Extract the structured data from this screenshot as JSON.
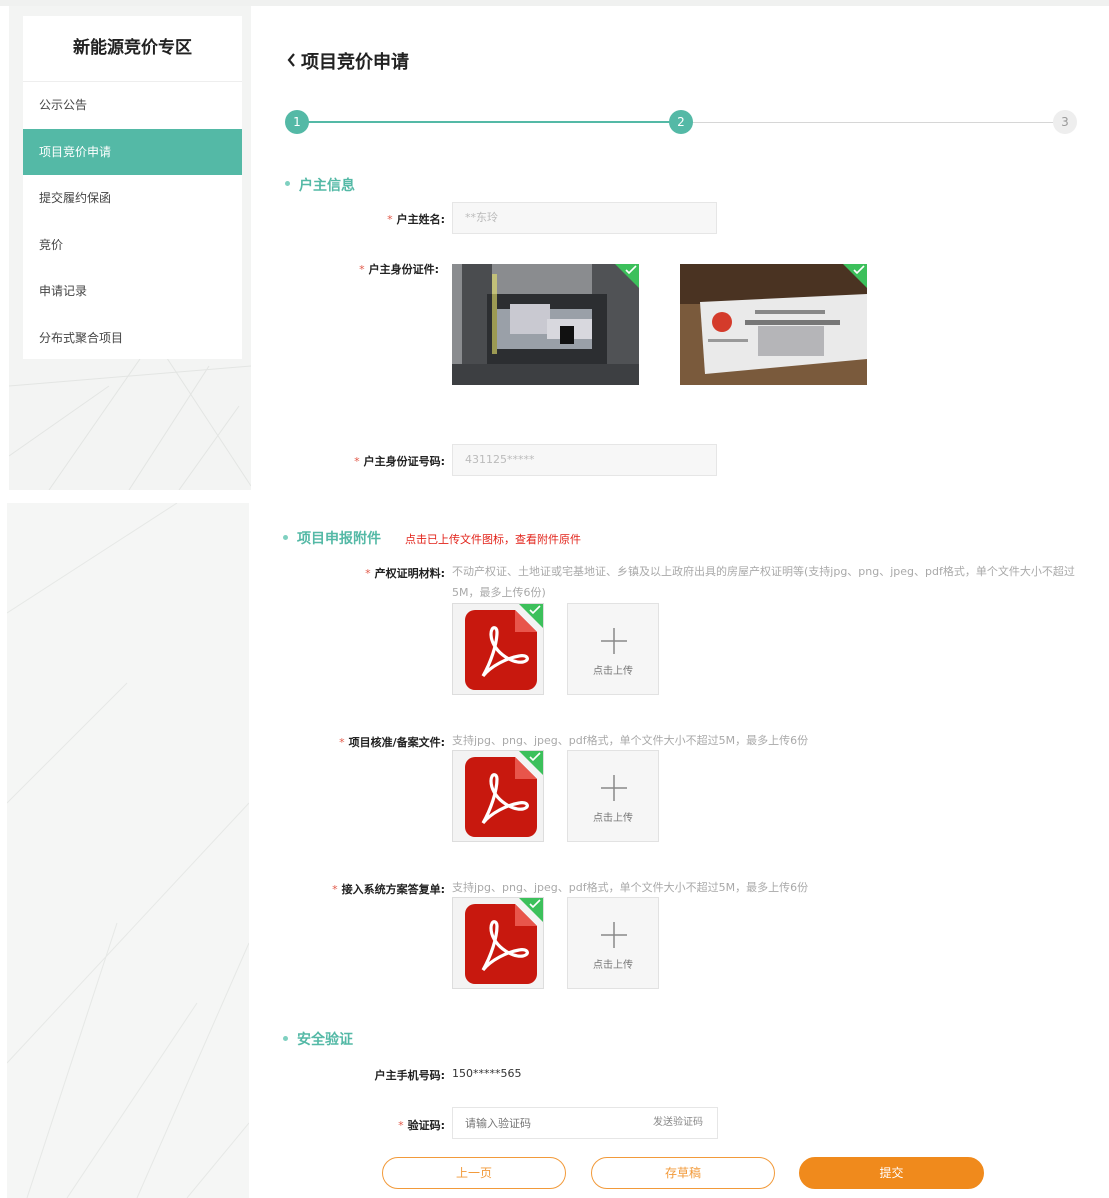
{
  "sidebar": {
    "title": "新能源竞价专区",
    "items": [
      {
        "label": "公示公告"
      },
      {
        "label": "项目竞价申请"
      },
      {
        "label": "提交履约保函"
      },
      {
        "label": "竞价"
      },
      {
        "label": "申请记录"
      },
      {
        "label": "分布式聚合项目"
      }
    ],
    "active_index": 1
  },
  "header": {
    "title": "项目竞价申请",
    "back_icon": "chevron-left-icon"
  },
  "steps": {
    "items": [
      "1",
      "2",
      "3"
    ],
    "current": 2
  },
  "owner_section": {
    "title": "户主信息",
    "name_label": "户主姓名:",
    "name_value": "**东玲",
    "id_doc_label": "户主身份证件:",
    "id_number_label": "户主身份证号码:",
    "id_number_value": "431125*****"
  },
  "attachments_section": {
    "title": "项目申报附件",
    "note": "点击已上传文件图标，查看附件原件",
    "fields": [
      {
        "label": "产权证明材料:",
        "hint": "不动产权证、土地证或宅基地证、乡镇及以上政府出具的房屋产权证明等(支持jpg、png、jpeg、pdf格式，单个文件大小不超过5M，最多上传6份)"
      },
      {
        "label": "项目核准/备案文件:",
        "hint": "支持jpg、png、jpeg、pdf格式，单个文件大小不超过5M，最多上传6份"
      },
      {
        "label": "接入系统方案答复单:",
        "hint": "支持jpg、png、jpeg、pdf格式，单个文件大小不超过5M，最多上传6份"
      }
    ],
    "upload_label": "点击上传",
    "file_icon": "pdf-icon"
  },
  "security_section": {
    "title": "安全验证",
    "phone_label": "户主手机号码:",
    "phone_value": "150*****565",
    "code_label": "验证码:",
    "code_placeholder": "请输入验证码",
    "send_code_label": "发送验证码"
  },
  "actions": {
    "prev": "上一页",
    "draft": "存草稿",
    "submit": "提交"
  },
  "required_mark": "*",
  "colors": {
    "accent": "#54b9a6",
    "orange": "#f08a1c",
    "check": "#3cc05b",
    "required": "#e25a4a"
  }
}
